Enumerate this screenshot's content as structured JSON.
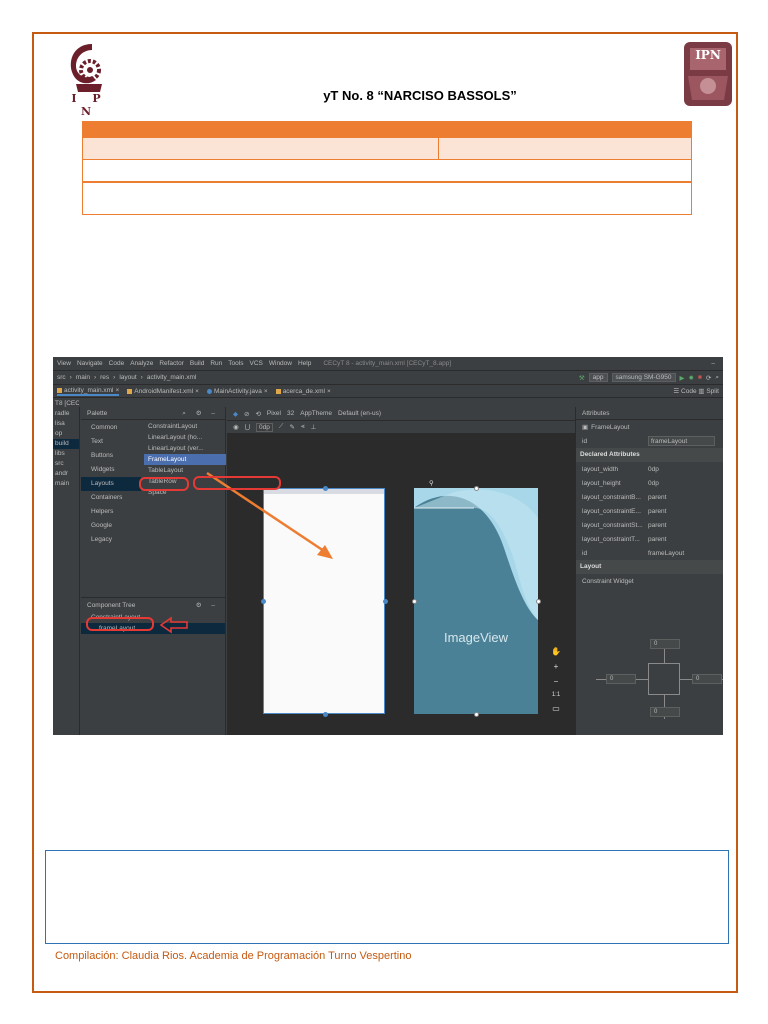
{
  "header": {
    "school_title": "yT No. 8 “NARCISO BASSOLS”",
    "logo_left_text": "I P N",
    "logo_right_text": "IPN"
  },
  "ide": {
    "menu": [
      "View",
      "Navigate",
      "Code",
      "Analyze",
      "Refactor",
      "Build",
      "Run",
      "Tools",
      "VCS",
      "Window",
      "Help"
    ],
    "window_title": "CECyT 8 - activity_main.xml [CECyT_8.app]",
    "breadcrumb": [
      "src",
      "main",
      "res",
      "layout",
      "activity_main.xml"
    ],
    "run_config": "app",
    "device": "samsung SM-G950",
    "tabs": [
      "activity_main.xml",
      "AndroidManifest.xml",
      "MainActivity.java",
      "acerca_de.xml"
    ],
    "project_items": [
      "radle",
      "lisa",
      "op",
      "build",
      "libs",
      "src",
      "andr",
      "main"
    ],
    "project_title": "T8 [CECyT",
    "palette_title": "Palette",
    "palette_categories": [
      "Common",
      "Text",
      "Buttons",
      "Widgets",
      "Layouts",
      "Containers",
      "Helpers",
      "Google",
      "Legacy"
    ],
    "palette_items": [
      "ConstraintLayout",
      "LinearLayout (ho...",
      "LinearLayout (ver...",
      "FrameLayout",
      "TableLayout",
      "TableRow",
      "Space"
    ],
    "design_toolbar": [
      "Pixel",
      "32",
      "AppTheme",
      "Default (en-us)"
    ],
    "margin_value": "0dp",
    "component_tree_title": "Component Tree",
    "component_tree_items": [
      "ConstraintLayout",
      "frameLayout"
    ],
    "imageview_label": "ImageView",
    "zoom_ratio": "1:1",
    "view_modes": [
      "Code",
      "Split"
    ],
    "attributes": {
      "title": "Attributes",
      "component": "FrameLayout",
      "id_label": "id",
      "id_value": "frameLayout",
      "declared_title": "Declared Attributes",
      "declared": [
        {
          "key": "layout_width",
          "value": "0dp"
        },
        {
          "key": "layout_height",
          "value": "0dp"
        },
        {
          "key": "layout_constraintB...",
          "value": "parent"
        },
        {
          "key": "layout_constraintE...",
          "value": "parent"
        },
        {
          "key": "layout_constraintSt...",
          "value": "parent"
        },
        {
          "key": "layout_constraintT...",
          "value": "parent"
        },
        {
          "key": "id",
          "value": "frameLayout"
        }
      ],
      "layout_title": "Layout",
      "constraint_widget": "Constraint Widget",
      "constraint_values": [
        "0",
        "0",
        "0",
        "0"
      ]
    }
  },
  "footer": {
    "compilation": "Compilación: Claudia Rios. Academia de Programación Turno Vespertino"
  },
  "colors": {
    "orange": "#ed7d31",
    "light_orange": "#fbe4d5",
    "blue_border": "#2e74b5"
  }
}
